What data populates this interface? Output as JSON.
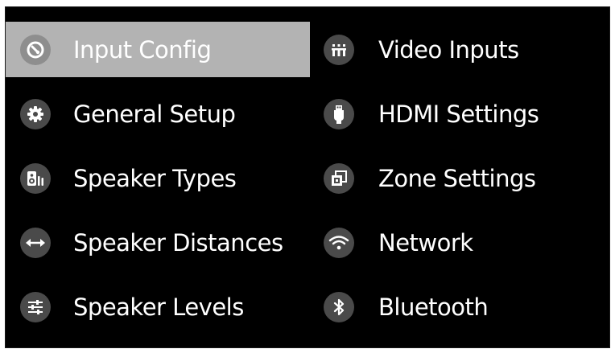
{
  "menu": {
    "left": [
      {
        "label": "Input Config",
        "icon": "input-config-icon",
        "selected": true
      },
      {
        "label": "General Setup",
        "icon": "gear-icon",
        "selected": false
      },
      {
        "label": "Speaker Types",
        "icon": "speaker-icon",
        "selected": false
      },
      {
        "label": "Speaker Distances",
        "icon": "double-arrow-icon",
        "selected": false
      },
      {
        "label": "Speaker Levels",
        "icon": "sliders-icon",
        "selected": false
      }
    ],
    "right": [
      {
        "label": "Video Inputs",
        "icon": "video-inputs-icon",
        "selected": false
      },
      {
        "label": "HDMI Settings",
        "icon": "hdmi-plug-icon",
        "selected": false
      },
      {
        "label": "Zone Settings",
        "icon": "zone-icon",
        "selected": false
      },
      {
        "label": "Network",
        "icon": "wifi-icon",
        "selected": false
      },
      {
        "label": "Bluetooth",
        "icon": "bluetooth-icon",
        "selected": false
      }
    ]
  },
  "colors": {
    "background": "#000000",
    "selected_background": "#b3b3b3",
    "icon_background": "#4a4a4a",
    "text": "#ffffff"
  }
}
